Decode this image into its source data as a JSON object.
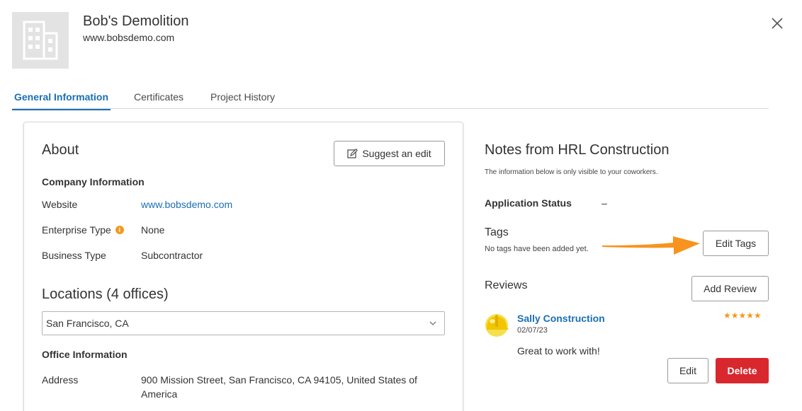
{
  "header": {
    "company_name": "Bob's Demolition",
    "company_url": "www.bobsdemo.com",
    "logo_icon": "building-icon",
    "close_icon": "close-icon"
  },
  "tabs": [
    {
      "label": "General Information",
      "active": true
    },
    {
      "label": "Certificates",
      "active": false
    },
    {
      "label": "Project History",
      "active": false
    }
  ],
  "about": {
    "title": "About",
    "suggest_edit_label": "Suggest an edit",
    "company_info_heading": "Company Information",
    "rows": [
      {
        "label": "Website",
        "value": "www.bobsdemo.com"
      },
      {
        "label": "Enterprise Type",
        "value": "None"
      },
      {
        "label": "Business Type",
        "value": "Subcontractor"
      }
    ],
    "locations_title": "Locations (4 offices)",
    "selected_location": "San Francisco, CA",
    "office_info_heading": "Office Information",
    "address_label": "Address",
    "address_value": "900 Mission Street, San Francisco, CA 94105, United States of America"
  },
  "notes": {
    "title": "Notes from HRL Construction",
    "subtitle": "The information below is only visible to your coworkers.",
    "application_status_label": "Application Status",
    "application_status_value": "–",
    "tags_label": "Tags",
    "tags_empty": "No tags have been added yet.",
    "edit_tags_label": "Edit Tags",
    "reviews_label": "Reviews",
    "add_review_label": "Add Review",
    "review": {
      "reviewer": "Sally Construction",
      "date": "02/07/23",
      "stars": "★★★★★",
      "rating": 5,
      "text": "Great to work with!",
      "edit_label": "Edit",
      "delete_label": "Delete"
    }
  },
  "colors": {
    "accent": "#1a6fb5",
    "danger": "#d9272e",
    "star": "#f29a1c",
    "arrow": "#f7931e"
  }
}
